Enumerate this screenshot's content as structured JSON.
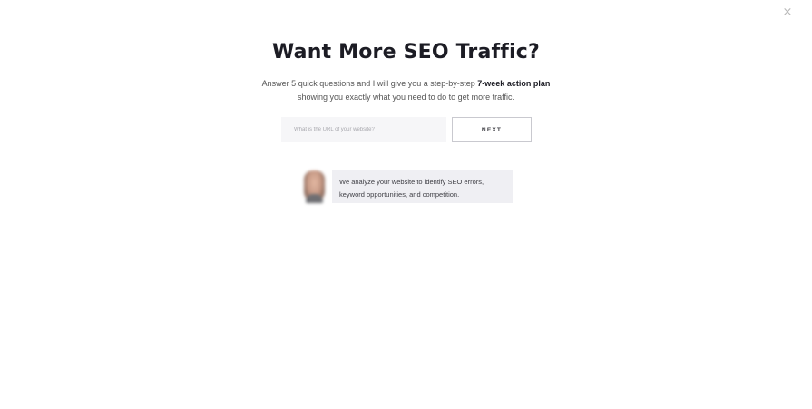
{
  "close": {
    "symbol": "×"
  },
  "hero": {
    "title": "Want More SEO Traffic?",
    "subtitle_line1_prefix": "Answer 5 quick questions and I will give you a step-by-step ",
    "subtitle_line1_bold": "7-week action plan",
    "subtitle_line2": "showing you exactly what you need to do to get more traffic."
  },
  "form": {
    "url_placeholder": "What is the URL of your website?",
    "url_value": "",
    "next_label": "NEXT"
  },
  "message": {
    "avatar_icon": "person-avatar",
    "text_line1": "We analyze your website to identify SEO errors,",
    "text_line2": "keyword opportunities, and competition."
  }
}
